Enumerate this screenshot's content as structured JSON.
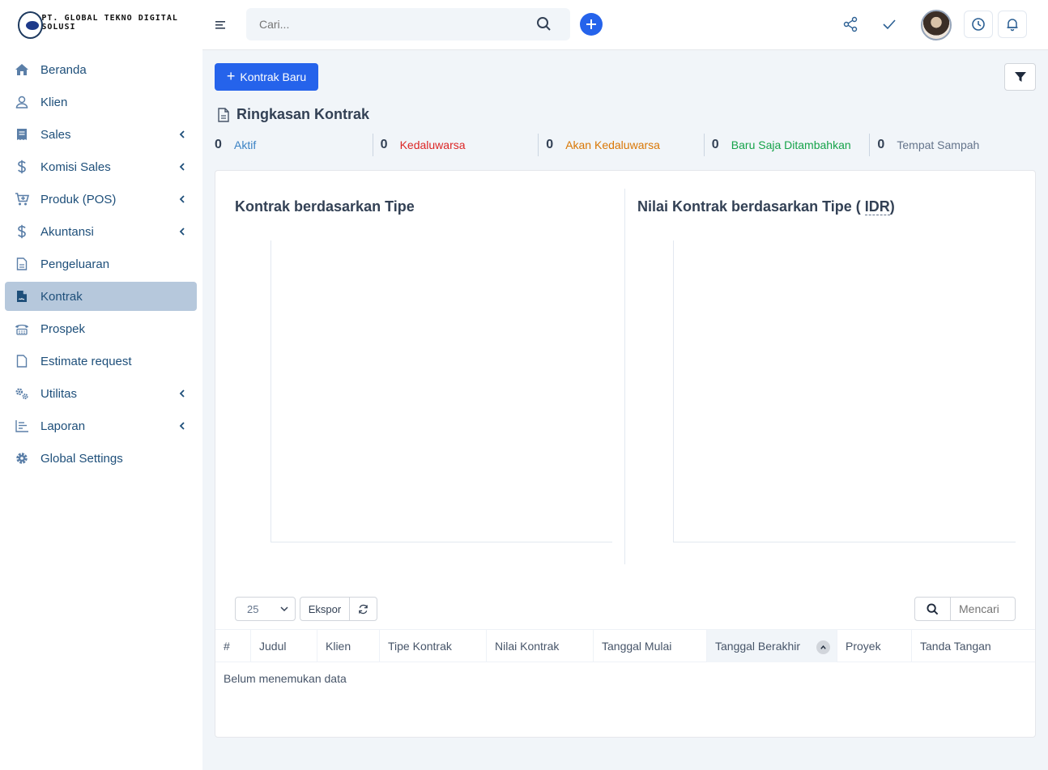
{
  "brand": {
    "name": "PT. GLOBAL TEKNO DIGITAL SOLUSI"
  },
  "sidebar": {
    "items": [
      {
        "label": "Beranda",
        "icon": "home-icon",
        "has_submenu": false
      },
      {
        "label": "Klien",
        "icon": "user-icon",
        "has_submenu": false
      },
      {
        "label": "Sales",
        "icon": "receipt-icon",
        "has_submenu": true
      },
      {
        "label": "Komisi Sales",
        "icon": "dollar-icon",
        "has_submenu": true
      },
      {
        "label": "Produk (POS)",
        "icon": "cart-plus-icon",
        "has_submenu": true
      },
      {
        "label": "Akuntansi",
        "icon": "dollar-icon",
        "has_submenu": true
      },
      {
        "label": "Pengeluaran",
        "icon": "document-icon",
        "has_submenu": false
      },
      {
        "label": "Kontrak",
        "icon": "contract-icon",
        "has_submenu": false,
        "active": true
      },
      {
        "label": "Prospek",
        "icon": "phone-icon",
        "has_submenu": false
      },
      {
        "label": "Estimate request",
        "icon": "file-icon",
        "has_submenu": false
      },
      {
        "label": "Utilitas",
        "icon": "cogs-icon",
        "has_submenu": true
      },
      {
        "label": "Laporan",
        "icon": "chart-icon",
        "has_submenu": true
      },
      {
        "label": "Global Settings",
        "icon": "gear-icon",
        "has_submenu": false
      }
    ]
  },
  "topbar": {
    "search_placeholder": "Cari..."
  },
  "toolbar": {
    "new_contract_label": "Kontrak Baru"
  },
  "summary": {
    "title": "Ringkasan Kontrak",
    "stats": [
      {
        "count": "0",
        "label": "Aktif",
        "color": "#3b82c4"
      },
      {
        "count": "0",
        "label": "Kedaluwarsa",
        "color": "#dc2626"
      },
      {
        "count": "0",
        "label": "Akan Kedaluwarsa",
        "color": "#d97706"
      },
      {
        "count": "0",
        "label": "Baru Saja Ditambahkan",
        "color": "#16a34a"
      },
      {
        "count": "0",
        "label": "Tempat Sampah",
        "color": "#64748b"
      }
    ]
  },
  "charts": {
    "left_title": "Kontrak berdasarkan Tipe",
    "right_title_prefix": "Nilai Kontrak berdasarkan Tipe ( ",
    "right_title_currency": "IDR",
    "right_title_suffix": ")"
  },
  "chart_data": [
    {
      "type": "bar",
      "title": "Kontrak berdasarkan Tipe",
      "categories": [],
      "values": []
    },
    {
      "type": "bar",
      "title": "Nilai Kontrak berdasarkan Tipe ( IDR)",
      "categories": [],
      "values": []
    }
  ],
  "table": {
    "page_size": "25",
    "export_label": "Ekspor",
    "search_placeholder": "Mencari",
    "columns": [
      "#",
      "Judul",
      "Klien",
      "Tipe Kontrak",
      "Nilai Kontrak",
      "Tanggal Mulai",
      "Tanggal Berakhir",
      "Proyek",
      "Tanda Tangan"
    ],
    "empty_text": "Belum menemukan data"
  },
  "colors": {
    "primary": "#2563eb",
    "sidebar_active": "#b6c8dc",
    "sidebar_text": "#1e4f7a"
  }
}
